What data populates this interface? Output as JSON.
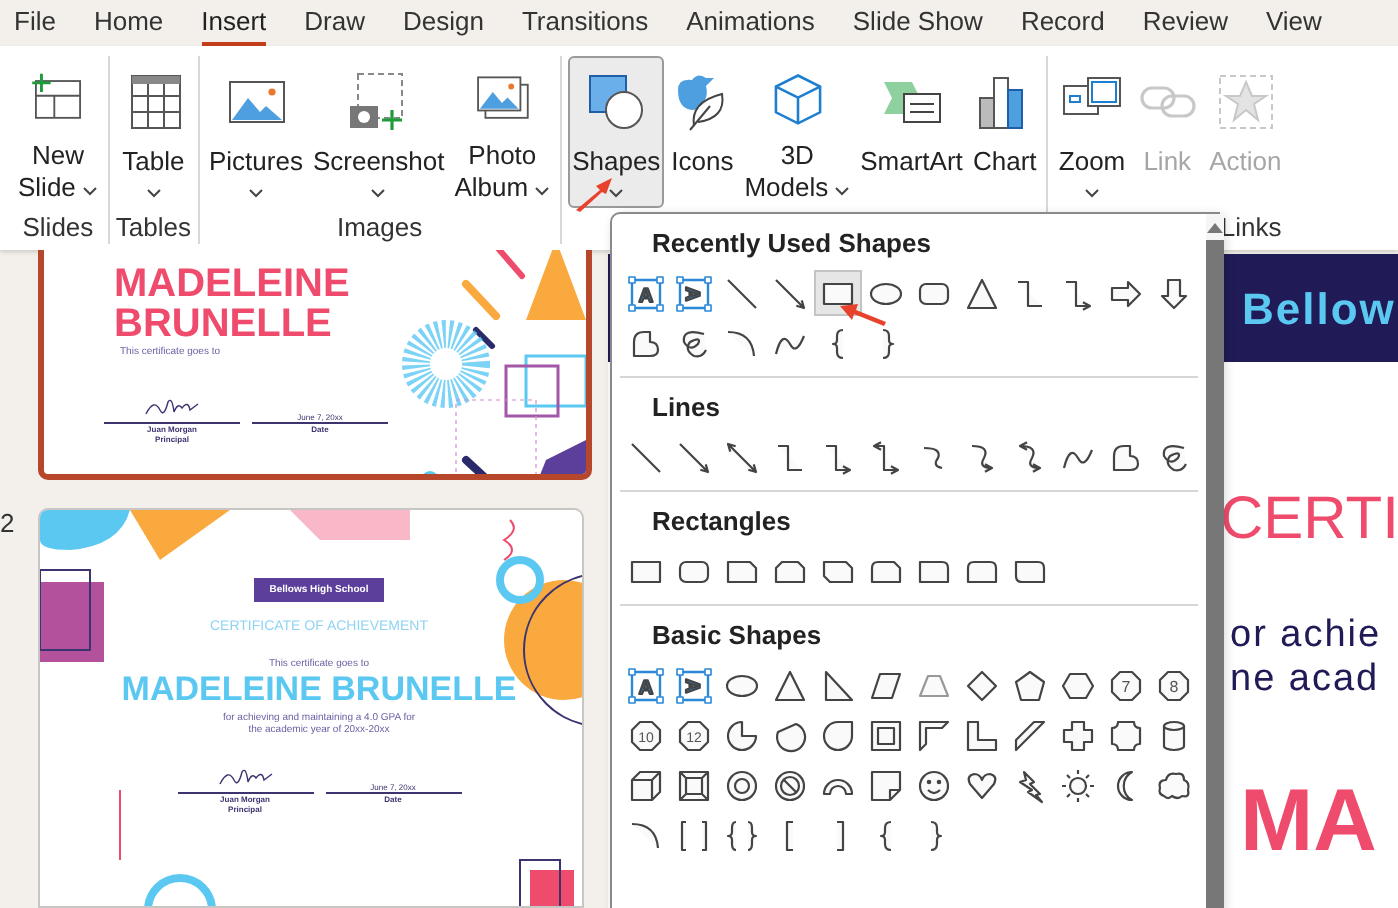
{
  "menu_tabs": [
    {
      "label": "File",
      "selected": false
    },
    {
      "label": "Home",
      "selected": false
    },
    {
      "label": "Insert",
      "selected": true
    },
    {
      "label": "Draw",
      "selected": false
    },
    {
      "label": "Design",
      "selected": false
    },
    {
      "label": "Transitions",
      "selected": false
    },
    {
      "label": "Animations",
      "selected": false
    },
    {
      "label": "Slide Show",
      "selected": false
    },
    {
      "label": "Record",
      "selected": false
    },
    {
      "label": "Review",
      "selected": false
    },
    {
      "label": "View",
      "selected": false
    }
  ],
  "ribbon": {
    "groups": [
      {
        "label": "Slides",
        "buttons": [
          {
            "kind": "new-slide",
            "lines": [
              "New",
              "Slide"
            ],
            "dropdown": true,
            "disabled": false,
            "pressed": false
          }
        ]
      },
      {
        "label": "Tables",
        "buttons": [
          {
            "kind": "table",
            "lines": [
              "Table"
            ],
            "dropdown": true,
            "disabled": false,
            "pressed": false
          }
        ]
      },
      {
        "label": "Images",
        "buttons": [
          {
            "kind": "pictures",
            "lines": [
              "Pictures"
            ],
            "dropdown": true,
            "disabled": false,
            "pressed": false
          },
          {
            "kind": "screenshot",
            "lines": [
              "Screenshot"
            ],
            "dropdown": true,
            "disabled": false,
            "pressed": false
          },
          {
            "kind": "photo-album",
            "lines": [
              "Photo",
              "Album"
            ],
            "dropdown": true,
            "disabled": false,
            "pressed": false
          }
        ]
      },
      {
        "buttons": [
          {
            "kind": "shapes",
            "lines": [
              "Shapes"
            ],
            "dropdown": true,
            "disabled": false,
            "pressed": true
          },
          {
            "kind": "icons",
            "lines": [
              "Icons"
            ],
            "dropdown": false,
            "disabled": false,
            "pressed": false
          },
          {
            "kind": "models",
            "lines": [
              "3D",
              "Models"
            ],
            "dropdown": true,
            "disabled": false,
            "pressed": false
          },
          {
            "kind": "smartart",
            "lines": [
              "SmartArt"
            ],
            "dropdown": false,
            "disabled": false,
            "pressed": false
          },
          {
            "kind": "chart",
            "lines": [
              "Chart"
            ],
            "dropdown": false,
            "disabled": false,
            "pressed": false
          }
        ]
      },
      {
        "label": "Links",
        "buttons": [
          {
            "kind": "zoom",
            "lines": [
              "Zoom"
            ],
            "dropdown": true,
            "disabled": false,
            "pressed": false
          },
          {
            "kind": "link",
            "lines": [
              "Link"
            ],
            "dropdown": false,
            "disabled": true,
            "pressed": false
          },
          {
            "kind": "action",
            "lines": [
              "Action"
            ],
            "dropdown": false,
            "disabled": true,
            "pressed": false
          }
        ]
      }
    ]
  },
  "slides": [
    {
      "kind": "name-top",
      "selected": true,
      "name_lines": [
        "MADELEINE",
        "BRUNELLE"
      ],
      "goes_to": "This certificate goes to",
      "signer": "Juan Morgan",
      "signer_role": "Principal",
      "date": "June 7, 20xx",
      "date_label": "Date"
    },
    {
      "kind": "full",
      "number": "2",
      "selected": false,
      "school": "Bellows High School",
      "title": "CERTIFICATE OF ACHIEVEMENT",
      "goes_to": "This certificate goes to",
      "name": "MADELEINE BRUNELLE",
      "reason_lines": [
        "for achieving and maintaining a 4.0 GPA for",
        "the academic year of 20xx-20xx"
      ],
      "signer": "Juan Morgan",
      "signer_role": "Principal",
      "date": "June 7, 20xx",
      "date_label": "Date"
    }
  ],
  "main_slide": {
    "header": "Bellow",
    "title": "CERTI",
    "lines": [
      "or achie",
      "ne acad"
    ],
    "name": "MA"
  },
  "shapes_menu": {
    "sections": [
      {
        "title": "Recently Used Shapes",
        "shapes": [
          {
            "kind": "textbox",
            "label": "A",
            "selected": false
          },
          {
            "kind": "vtextbox",
            "label": "A",
            "selected": false
          },
          {
            "kind": "line",
            "selected": false
          },
          {
            "kind": "arrow-line",
            "selected": false
          },
          {
            "kind": "rect",
            "selected": true
          },
          {
            "kind": "oval",
            "selected": false
          },
          {
            "kind": "rounded-rect",
            "selected": false
          },
          {
            "kind": "triangle",
            "selected": false
          },
          {
            "kind": "elbow",
            "selected": false
          },
          {
            "kind": "elbow-arrow",
            "selected": false
          },
          {
            "kind": "right-arrow",
            "selected": false
          },
          {
            "kind": "down-arrow",
            "selected": false
          },
          {
            "kind": "freeform",
            "selected": false
          },
          {
            "kind": "scribble",
            "selected": false
          },
          {
            "kind": "arc",
            "selected": false
          },
          {
            "kind": "curve",
            "selected": false
          },
          {
            "kind": "left-brace",
            "selected": false
          },
          {
            "kind": "right-brace",
            "selected": false
          }
        ]
      },
      {
        "title": "Lines",
        "shapes": [
          {
            "kind": "line"
          },
          {
            "kind": "arrow-line"
          },
          {
            "kind": "double-arrow"
          },
          {
            "kind": "elbow"
          },
          {
            "kind": "elbow-arrow"
          },
          {
            "kind": "elbow-double"
          },
          {
            "kind": "curved-connector"
          },
          {
            "kind": "curved-arrow"
          },
          {
            "kind": "curved-double"
          },
          {
            "kind": "curve"
          },
          {
            "kind": "freeform"
          },
          {
            "kind": "scribble"
          }
        ]
      },
      {
        "title": "Rectangles",
        "shapes": [
          {
            "kind": "rect"
          },
          {
            "kind": "rounded-rect"
          },
          {
            "kind": "snip-one"
          },
          {
            "kind": "snip-same"
          },
          {
            "kind": "snip-diag"
          },
          {
            "kind": "snip-round"
          },
          {
            "kind": "round-one"
          },
          {
            "kind": "round-same"
          },
          {
            "kind": "round-diag"
          }
        ]
      },
      {
        "title": "Basic Shapes",
        "shapes": [
          {
            "kind": "textbox",
            "label": "A"
          },
          {
            "kind": "vtextbox",
            "label": "A"
          },
          {
            "kind": "oval"
          },
          {
            "kind": "triangle"
          },
          {
            "kind": "right-triangle"
          },
          {
            "kind": "parallelogram"
          },
          {
            "kind": "trapezoid"
          },
          {
            "kind": "diamond"
          },
          {
            "kind": "pentagon"
          },
          {
            "kind": "hexagon"
          },
          {
            "kind": "polygon",
            "label": "7"
          },
          {
            "kind": "polygon",
            "label": "8"
          },
          {
            "kind": "polygon",
            "label": "10"
          },
          {
            "kind": "polygon",
            "label": "12"
          },
          {
            "kind": "pie"
          },
          {
            "kind": "chord"
          },
          {
            "kind": "teardrop"
          },
          {
            "kind": "frame"
          },
          {
            "kind": "half-frame"
          },
          {
            "kind": "l-shape"
          },
          {
            "kind": "diagonal-stripe"
          },
          {
            "kind": "cross"
          },
          {
            "kind": "plaque"
          },
          {
            "kind": "can"
          },
          {
            "kind": "cube"
          },
          {
            "kind": "bevel"
          },
          {
            "kind": "donut"
          },
          {
            "kind": "no-symbol"
          },
          {
            "kind": "block-arc"
          },
          {
            "kind": "folded-corner"
          },
          {
            "kind": "smiley"
          },
          {
            "kind": "heart"
          },
          {
            "kind": "lightning"
          },
          {
            "kind": "sun"
          },
          {
            "kind": "moon"
          },
          {
            "kind": "cloud"
          },
          {
            "kind": "arc"
          },
          {
            "kind": "bracket-pair"
          },
          {
            "kind": "brace-pair"
          },
          {
            "kind": "left-bracket"
          },
          {
            "kind": "right-bracket"
          },
          {
            "kind": "left-brace"
          },
          {
            "kind": "right-brace"
          }
        ]
      }
    ]
  }
}
